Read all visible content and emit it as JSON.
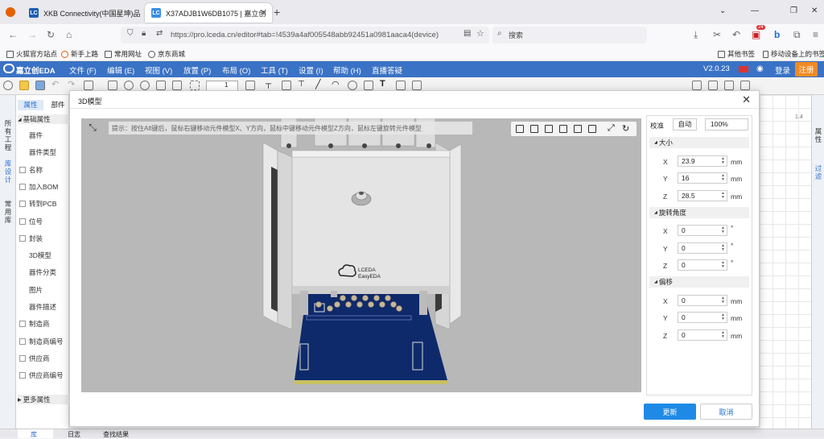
{
  "browser": {
    "tabs": [
      {
        "icon": "LC",
        "title": "XKB Connectivity(中国星坤)品",
        "color": "#1f5fb4"
      },
      {
        "icon": "LC",
        "title": "X37ADJB1W6DB1075 | 嘉立创",
        "color": "#3a8ee6"
      }
    ],
    "url": "https://pro.lceda.cn/editor#tab=!4539a4af005548abb92451a0981aaca4(device)",
    "search_placeholder": "搜索",
    "notification_badge": "24",
    "bookmarks": [
      "火狐官方站点",
      "新手上路",
      "常用网址",
      "京东商城"
    ],
    "bookmarks_right": [
      "其他书签",
      "移动设备上的书签"
    ]
  },
  "app": {
    "logo": "嘉立创EDA",
    "menu": [
      "文件 (F)",
      "编辑 (E)",
      "视图 (V)",
      "放置 (P)",
      "布局 (O)",
      "工具 (T)",
      "设置 (I)",
      "帮助 (H)",
      "直播答疑"
    ],
    "version": "V2.0.23",
    "login": "登录",
    "register": "注册",
    "zoom_select": "1"
  },
  "left_strip": [
    "所有工程",
    "库设计",
    "常用库"
  ],
  "left_panel": {
    "tabs": [
      "属性",
      "部件"
    ],
    "section": "基础属性",
    "items": [
      {
        "label": "器件",
        "check": false
      },
      {
        "label": "器件类型",
        "check": false
      },
      {
        "label": "名称",
        "check": true
      },
      {
        "label": "加入BOM",
        "check": true
      },
      {
        "label": "转到PCB",
        "check": true
      },
      {
        "label": "位号",
        "check": true
      },
      {
        "label": "封装",
        "check": true
      },
      {
        "label": "3D模型",
        "check": false
      },
      {
        "label": "器件分类",
        "check": false
      },
      {
        "label": "图片",
        "check": false
      },
      {
        "label": "器件描述",
        "check": false
      },
      {
        "label": "制造商",
        "check": true
      },
      {
        "label": "制造商编号",
        "check": true
      },
      {
        "label": "供应商",
        "check": true
      },
      {
        "label": "供应商编号",
        "check": true
      }
    ],
    "more": "更多属性"
  },
  "right_strip": [
    "属性",
    "过滤"
  ],
  "ruler_mark": "1.4",
  "modal": {
    "title": "3D模型",
    "hint": "提示：按住Alt键后，鼠标右键移动元件模型X、Y方向，鼠标中键移动元件模型Z方向，鼠标左键旋转元件模型",
    "model_logo_top": "LCEDA",
    "model_logo_bottom": "EasyEDA",
    "calibrate_label": "校准",
    "auto_button": "自动",
    "scale": "100%",
    "size": {
      "title": "大小",
      "x": "23.9",
      "y": "16",
      "z": "28.5",
      "unit": "mm"
    },
    "rotation": {
      "title": "旋转角度",
      "x": "0",
      "y": "0",
      "z": "0",
      "unit": "°"
    },
    "offset": {
      "title": "偏移",
      "x": "0",
      "y": "0",
      "z": "0",
      "unit": "mm"
    },
    "update_button": "更新",
    "cancel_button": "取消"
  },
  "status": [
    "库",
    "日志",
    "查找结果"
  ],
  "colors": {
    "brand": "#3a72c5",
    "primary_button": "#1e8ae6",
    "register": "#f08a24",
    "pcb": "#0e2a6b"
  }
}
